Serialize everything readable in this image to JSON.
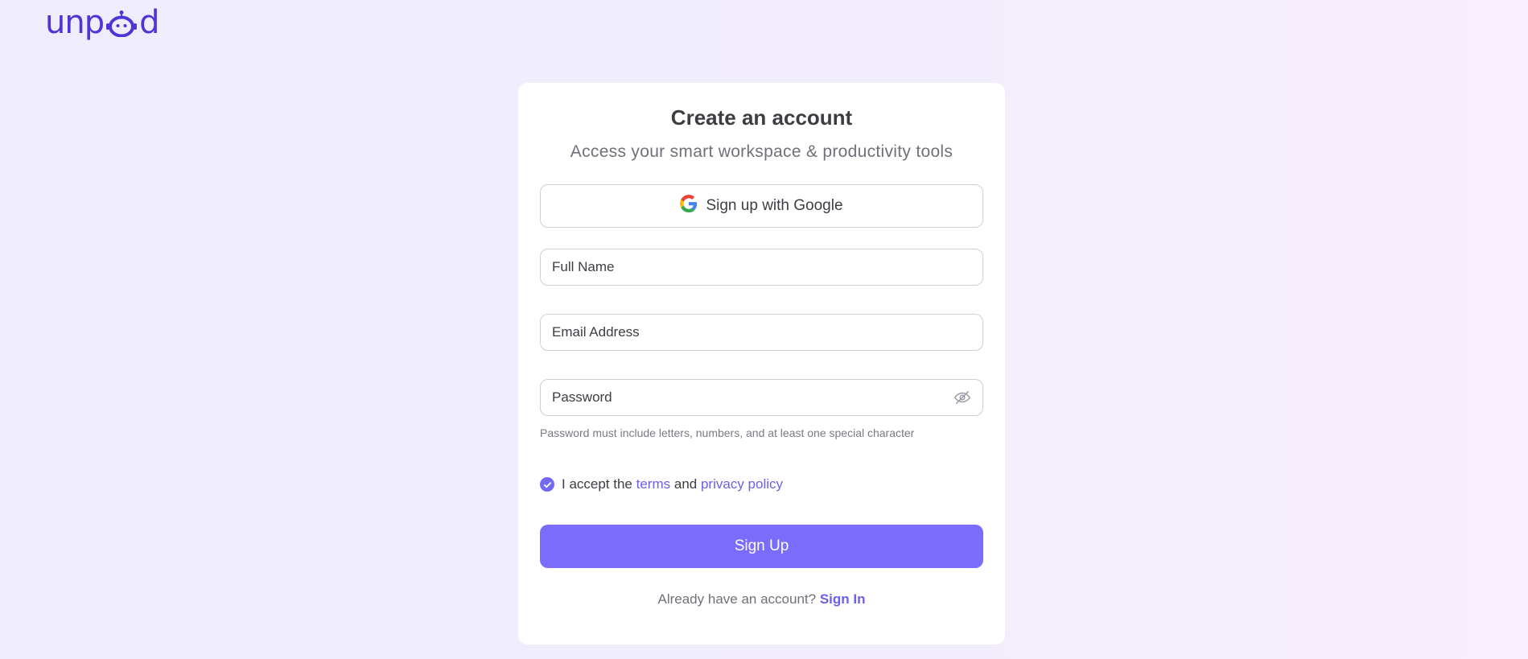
{
  "brand": {
    "logo_prefix": "unp",
    "logo_suffix": "d",
    "logo_icon": "robot-icon",
    "color": "#4c36d6"
  },
  "form": {
    "title": "Create an account",
    "subtitle": "Access your smart workspace & productivity tools",
    "google_button_label": "Sign up with Google",
    "google_icon": "google-icon",
    "full_name_placeholder": "Full Name",
    "email_placeholder": "Email Address",
    "password_placeholder": "Password",
    "password_toggle_icon": "eye-off-icon",
    "password_hint": "Password must include letters, numbers, and at least one special character",
    "accept_prefix": "I accept the",
    "terms_link": "terms",
    "and_text": "and",
    "privacy_link": "privacy policy",
    "terms_checked": true,
    "submit_label": "Sign Up",
    "signin_prompt": "Already have an account?",
    "signin_link": "Sign In"
  },
  "colors": {
    "accent": "#7b6cfb",
    "link": "#6c5fe8",
    "logo": "#4c36d6"
  }
}
